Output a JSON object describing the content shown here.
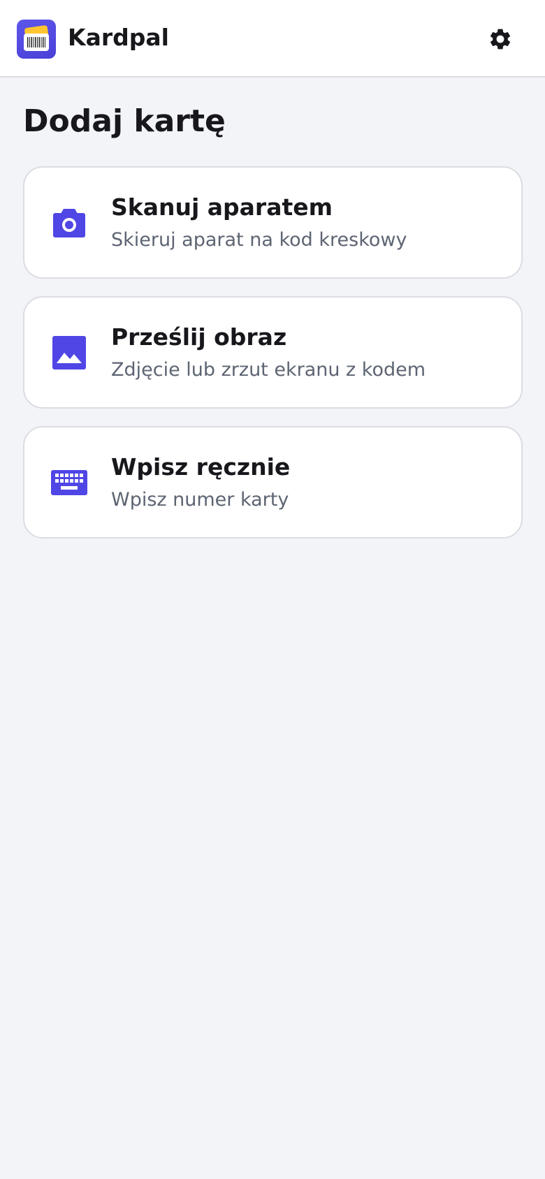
{
  "header": {
    "app_name": "Kardpal",
    "logo_icon": "card-barcode-logo",
    "settings_icon": "gear-icon"
  },
  "page": {
    "title": "Dodaj kartę"
  },
  "options": [
    {
      "icon": "camera-icon",
      "label": "Skanuj aparatem",
      "description": "Skieruj aparat na kod kreskowy"
    },
    {
      "icon": "image-icon",
      "label": "Prześlij obraz",
      "description": "Zdjęcie lub zrzut ekranu z kodem"
    },
    {
      "icon": "keyboard-icon",
      "label": "Wpisz ręcznie",
      "description": "Wpisz numer karty"
    }
  ],
  "colors": {
    "accent": "#4f46e5",
    "logo_card": "#ffc531",
    "background": "#f3f4f8",
    "card_background": "#ffffff",
    "text_primary": "#17171c",
    "text_secondary": "#5d6472"
  }
}
